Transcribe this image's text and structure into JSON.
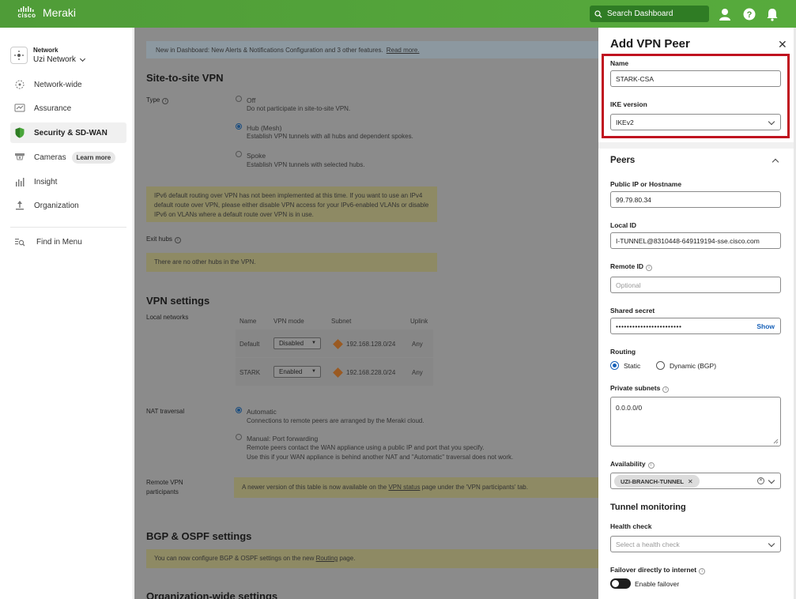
{
  "topbar": {
    "brand_small": "cisco",
    "brand": "Meraki",
    "search_placeholder": "Search Dashboard"
  },
  "sidebar": {
    "network_label": "Network",
    "network_name": "Uzi Network",
    "items": [
      {
        "label": "Network-wide",
        "icon": "network-wide-icon"
      },
      {
        "label": "Assurance",
        "icon": "assurance-icon"
      },
      {
        "label": "Security & SD-WAN",
        "icon": "shield-icon"
      },
      {
        "label": "Cameras",
        "icon": "camera-icon",
        "badge": "Learn more"
      },
      {
        "label": "Insight",
        "icon": "bar-chart-icon"
      },
      {
        "label": "Organization",
        "icon": "organization-icon"
      }
    ],
    "find_in_menu": "Find in Menu"
  },
  "main": {
    "banner_text": "New in Dashboard: New Alerts & Notifications Configuration and 3 other features.",
    "banner_link": "Read more.",
    "title": "Site-to-site VPN",
    "type_label": "Type",
    "type_options": [
      {
        "label": "Off",
        "desc": "Do not participate in site-to-site VPN.",
        "selected": false
      },
      {
        "label": "Hub (Mesh)",
        "desc": "Establish VPN tunnels with all hubs and dependent spokes.",
        "selected": true
      },
      {
        "label": "Spoke",
        "desc": "Establish VPN tunnels with selected hubs.",
        "selected": false
      }
    ],
    "ipv6_warning": "IPv6 default routing over VPN has not been implemented at this time. If you want to use an IPv4 default route over VPN, please either disable VPN access for your IPv6-enabled VLANs or disable IPv6 on VLANs where a default route over VPN is in use.",
    "exit_hubs_label": "Exit hubs",
    "exit_hubs_note": "There are no other hubs in the VPN.",
    "vpn_settings_title": "VPN settings",
    "local_networks_label": "Local networks",
    "table_headers": [
      "Name",
      "VPN mode",
      "Subnet",
      "Uplink"
    ],
    "table_rows": [
      {
        "name": "Default",
        "mode": "Disabled",
        "subnet": "192.168.128.0/24",
        "uplink": "Any"
      },
      {
        "name": "STARK",
        "mode": "Enabled",
        "subnet": "192.168.228.0/24",
        "uplink": "Any"
      }
    ],
    "nat_label": "NAT traversal",
    "nat_options": [
      {
        "label": "Automatic",
        "desc": "Connections to remote peers are arranged by the Meraki cloud.",
        "selected": true
      },
      {
        "label": "Manual: Port forwarding",
        "desc": "Remote peers contact the WAN appliance using a public IP and port that you specify.",
        "desc2": "Use this if your WAN appliance is behind another NAT and \"Automatic\" traversal does not work.",
        "selected": false
      }
    ],
    "remote_vpn_label_1": "Remote VPN",
    "remote_vpn_label_2": "participants",
    "remote_vpn_note_pre": "A newer version of this table is now available on the",
    "remote_vpn_note_link": "VPN status",
    "remote_vpn_note_post": "page under the 'VPN participants' tab.",
    "bgp_title": "BGP & OSPF settings",
    "bgp_note_pre": "You can now configure BGP & OSPF settings on the new",
    "bgp_note_link": "Routing",
    "bgp_note_post": "page.",
    "org_title": "Organization-wide settings"
  },
  "panel": {
    "title": "Add VPN Peer",
    "name_label": "Name",
    "name_value": "STARK-CSA",
    "ike_label": "IKE version",
    "ike_value": "IKEv2",
    "peers_title": "Peers",
    "public_ip_label": "Public IP or Hostname",
    "public_ip_value": "99.79.80.34",
    "local_id_label": "Local ID",
    "local_id_value": "I-TUNNEL@8310448-649119194-sse.cisco.com",
    "remote_id_label": "Remote ID",
    "remote_id_placeholder": "Optional",
    "secret_label": "Shared secret",
    "secret_value": "••••••••••••••••••••••••",
    "show_label": "Show",
    "routing_label": "Routing",
    "routing_static": "Static",
    "routing_dynamic": "Dynamic (BGP)",
    "subnets_label": "Private subnets",
    "subnets_value": "0.0.0.0/0",
    "availability_label": "Availability",
    "availability_chip": "UZI-BRANCH-TUNNEL",
    "tunnel_monitoring_title": "Tunnel monitoring",
    "health_check_label": "Health check",
    "health_check_placeholder": "Select a health check",
    "failover_label": "Failover directly to internet",
    "failover_toggle_label": "Enable failover"
  },
  "colors": {
    "brand_green": "#4f9c38",
    "highlight_red": "#c0121f",
    "link_blue": "#1660b8"
  }
}
